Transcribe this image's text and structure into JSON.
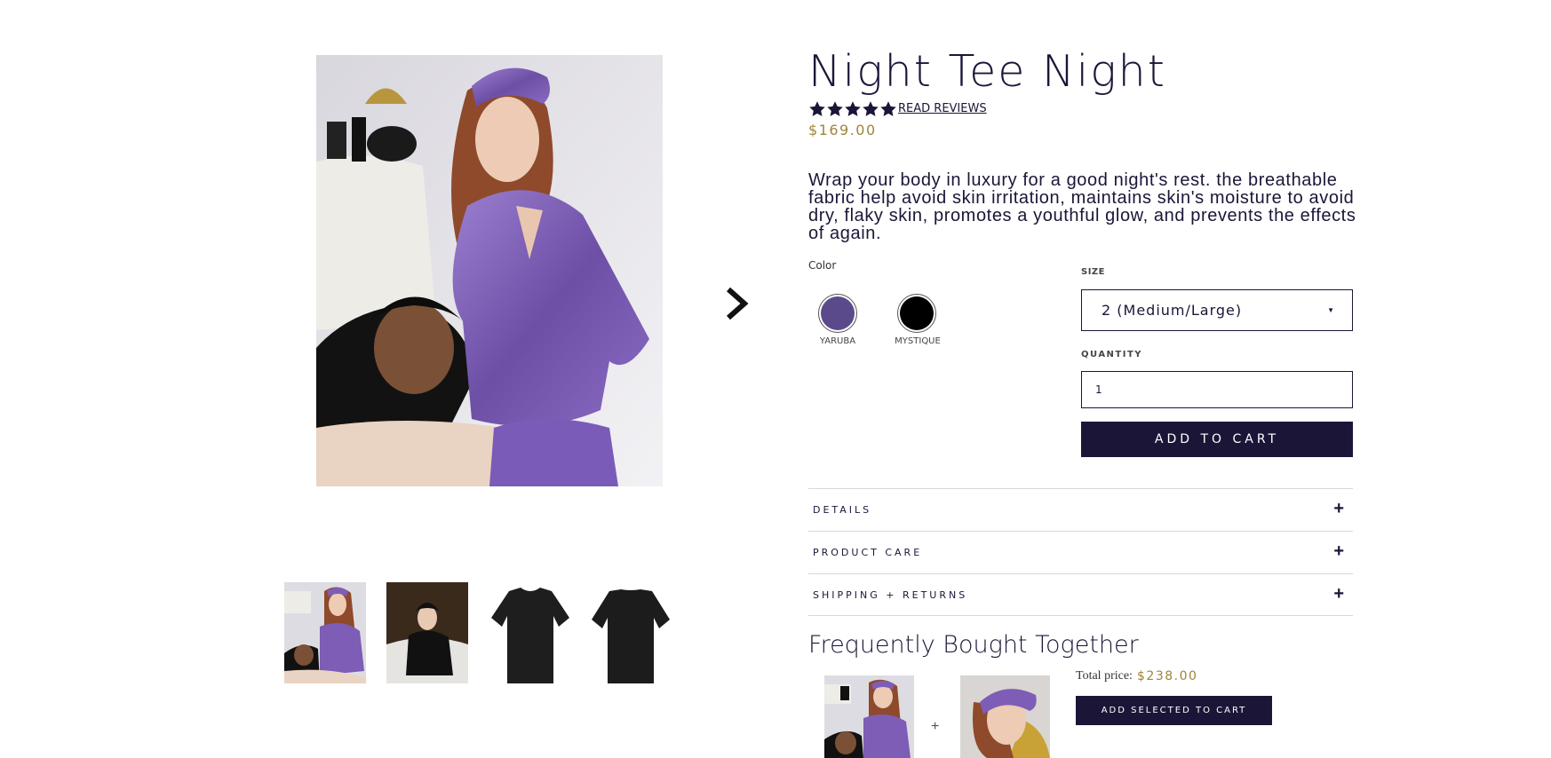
{
  "product": {
    "title": "Night Tee Night",
    "rating_stars": 5,
    "read_reviews": "READ REVIEWS",
    "price": "$169.00",
    "description": "Wrap your body in luxury for a good night's rest. the breathable fabric help avoid skin irritation, maintains skin's moisture to avoid dry, flaky skin, promotes a youthful glow, and prevents the effects of again."
  },
  "gallery": {
    "next_icon": "chevron-right-icon",
    "thumbnails": [
      "thumbnail-1",
      "thumbnail-2",
      "thumbnail-3",
      "thumbnail-4"
    ]
  },
  "color": {
    "label": "Color",
    "options": [
      {
        "name": "YARUBA",
        "hex": "#5b4a8b"
      },
      {
        "name": "MYSTIQUE",
        "hex": "#000000"
      }
    ]
  },
  "size": {
    "label": "SIZE",
    "selected": "2 (Medium/Large)"
  },
  "quantity": {
    "label": "QUANTITY",
    "value": "1"
  },
  "add_to_cart": "ADD TO CART",
  "accordion": [
    {
      "label": "DETAILS"
    },
    {
      "label": "PRODUCT CARE"
    },
    {
      "label": "SHIPPING + RETURNS"
    }
  ],
  "fbt": {
    "title": "Frequently Bought Together",
    "plus": "+",
    "total_label": "Total price:",
    "total_price": "$238.00",
    "button": "ADD SELECTED TO CART"
  },
  "colors": {
    "primary": "#1b1638",
    "gold": "#a0843c",
    "satin_purple": "#7d5db5"
  }
}
